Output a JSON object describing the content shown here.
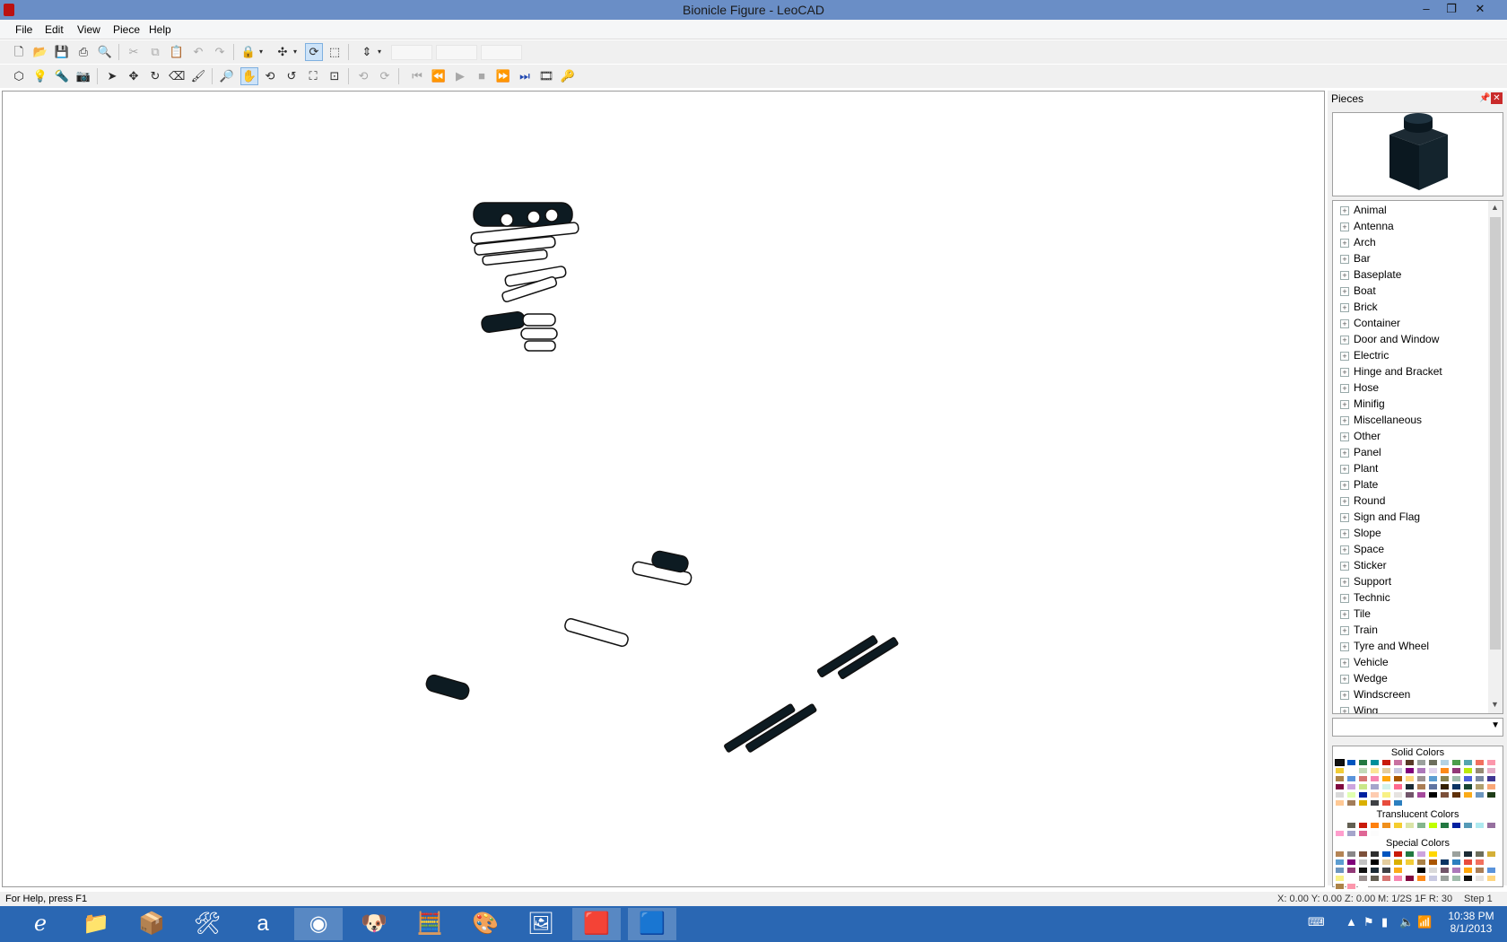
{
  "window": {
    "title": "Bionicle Figure - LeoCAD"
  },
  "menu": {
    "file": "File",
    "edit": "Edit",
    "view": "View",
    "piece": "Piece",
    "help": "Help"
  },
  "pieces_panel": {
    "title": "Pieces",
    "categories": [
      "Animal",
      "Antenna",
      "Arch",
      "Bar",
      "Baseplate",
      "Boat",
      "Brick",
      "Container",
      "Door and Window",
      "Electric",
      "Hinge and Bracket",
      "Hose",
      "Minifig",
      "Miscellaneous",
      "Other",
      "Panel",
      "Plant",
      "Plate",
      "Round",
      "Sign and Flag",
      "Slope",
      "Space",
      "Sticker",
      "Support",
      "Technic",
      "Tile",
      "Train",
      "Tyre and Wheel",
      "Vehicle",
      "Wedge",
      "Windscreen",
      "Wing"
    ],
    "combo_value": "",
    "solid_colors_label": "Solid Colors",
    "translucent_colors_label": "Translucent Colors",
    "special_colors_label": "Special Colors",
    "solid_palette": [
      "#111111",
      "#0055bf",
      "#237841",
      "#008f9b",
      "#c91a09",
      "#c870a0",
      "#583927",
      "#9ba19d",
      "#6d6e5c",
      "#b4d2e3",
      "#4b9f4a",
      "#55a5af",
      "#f2705e",
      "#fc97ac",
      "#f2cd37",
      "#ffffff",
      "#c2dab8",
      "#fbe696",
      "#e4cd9e",
      "#c9cae2",
      "#81007b",
      "#ac78ba",
      "#e1d5ed",
      "#fe8a18",
      "#923978",
      "#bbe90b",
      "#958a73",
      "#e4adc8",
      "#ac8247",
      "#5a93db",
      "#d67572",
      "#f785b1",
      "#ffa70b",
      "#a95500",
      "#ffd67f",
      "#9c9291",
      "#5c9dd1",
      "#8b844f",
      "#a0bcac",
      "#4c61db",
      "#7988a1",
      "#3f3691",
      "#80083f",
      "#cda4de",
      "#c9e788",
      "#a5a5cb",
      "#d3f2ea",
      "#ff698f",
      "#1b2a34",
      "#aa7d55",
      "#6074a1",
      "#352100",
      "#0a3463",
      "#184632",
      "#b0a06f",
      "#f9a777",
      "#d9d9d9",
      "#e0ffb0",
      "#0020a0",
      "#feccb0",
      "#f8f184",
      "#e6e3e0",
      "#72556a",
      "#a5499c",
      "#000000",
      "#7c503a",
      "#5f3109",
      "#fbab18",
      "#6c96bf",
      "#1f3d18",
      "#ffc995",
      "#a27d5a",
      "#dab000",
      "#3f4144",
      "#e84c3d",
      "#2c7fbf"
    ],
    "translucent_palette": [
      "#ffffff",
      "#635f52",
      "#c91a09",
      "#ff800d",
      "#f08f1c",
      "#f5cd2f",
      "#d9e4a7",
      "#84b68d",
      "#c0ff00",
      "#237841",
      "#0020a0",
      "#559ab7",
      "#aee9ef",
      "#96709f",
      "#ff9ecd",
      "#a5a5cb",
      "#df6695",
      "#fcfcfc"
    ],
    "special_palette": [
      "#b48455",
      "#898788",
      "#7c503a",
      "#2e2e2e",
      "#0055bf",
      "#c91a09",
      "#237841",
      "#cda4de",
      "#ffd700",
      "#ffffff",
      "#9ba19d",
      "#1b2a34",
      "#6d6e5c",
      "#d4af37",
      "#5c9dd1",
      "#81007b",
      "#c2c2c2",
      "#000000",
      "#e4cd9e",
      "#dab000",
      "#f2cd37",
      "#ac8247",
      "#a95500",
      "#0a3463",
      "#2c7fbf",
      "#e84c3d",
      "#f2705e",
      "#ffffff",
      "#6c96bf",
      "#923978",
      "#111111",
      "#1b2a34",
      "#3f4144",
      "#fbab18",
      "#ffffff",
      "#000000",
      "#d9d9d9",
      "#72556a",
      "#ac78ba",
      "#ffa70b",
      "#aa7d55",
      "#5a93db",
      "#f8f184",
      "#ffffff",
      "#9c9291",
      "#635f52",
      "#d67572",
      "#f785b1",
      "#80083f",
      "#fe8a18",
      "#c9cae2",
      "#9ba19d",
      "#a0bcac",
      "#111111",
      "#e6e3e0",
      "#ffd67f",
      "#ac8247",
      "#fc97ac",
      "#ffffff"
    ]
  },
  "status": {
    "help": "For Help, press F1",
    "coords": "X: 0.00 Y: 0.00 Z: 0.00",
    "mode": "M: 1/2S 1F R: 30",
    "step": "Step 1"
  },
  "taskbar": {
    "clock_time": "10:38 PM",
    "clock_date": "8/1/2013"
  }
}
